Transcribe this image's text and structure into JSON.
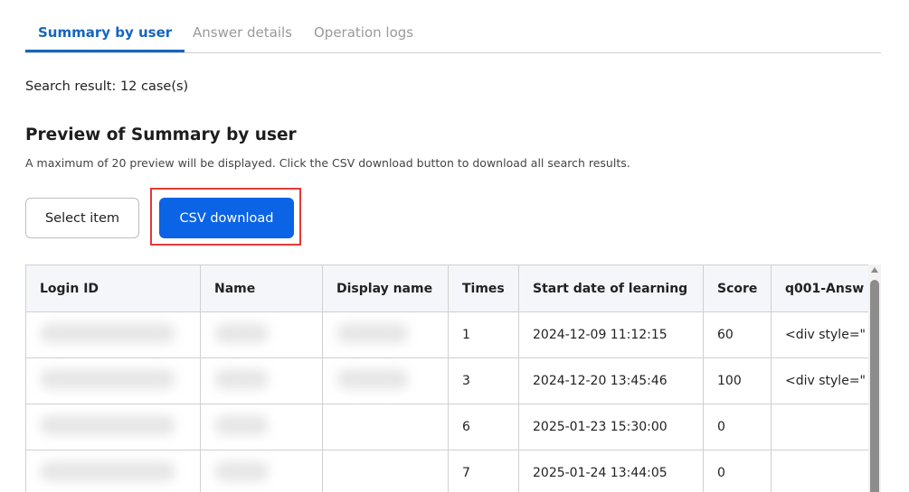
{
  "tabs": [
    {
      "label": "Summary by user",
      "active": true
    },
    {
      "label": "Answer details",
      "active": false
    },
    {
      "label": "Operation logs",
      "active": false
    }
  ],
  "search_result": "Search result: 12 case(s)",
  "section": {
    "title": "Preview of Summary by user",
    "note": "A maximum of 20 preview will be displayed. Click the CSV download button to download all search results."
  },
  "buttons": {
    "select_item": "Select item",
    "csv_download": "CSV download"
  },
  "colors": {
    "accent": "#1565c0",
    "primary_button": "#0b63e5",
    "highlight": "#e53935"
  },
  "table": {
    "columns": [
      "Login ID",
      "Name",
      "Display name",
      "Times",
      "Start date of learning",
      "Score",
      "q001-Answ"
    ],
    "rows": [
      {
        "times": "1",
        "start": "2024-12-09 11:12:15",
        "score": "60",
        "q001": "<div style=\""
      },
      {
        "times": "3",
        "start": "2024-12-20 13:45:46",
        "score": "100",
        "q001": "<div style=\""
      },
      {
        "times": "6",
        "start": "2025-01-23 15:30:00",
        "score": "0",
        "q001": ""
      },
      {
        "times": "7",
        "start": "2025-01-24 13:44:05",
        "score": "0",
        "q001": ""
      }
    ]
  }
}
